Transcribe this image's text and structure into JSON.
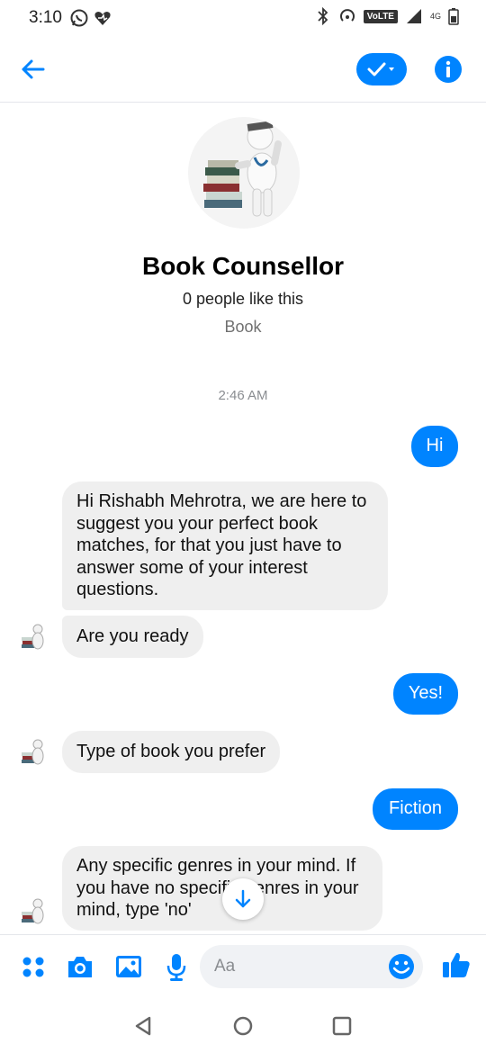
{
  "status_bar": {
    "time": "3:10",
    "volte": "VoLTE",
    "network": "4G",
    "icons": [
      "whatsapp-icon",
      "heart-icon",
      "bluetooth-icon",
      "hotspot-icon",
      "signal-icon",
      "battery-icon"
    ]
  },
  "header": {
    "icons": [
      "back-arrow-icon",
      "check-icon",
      "chevron-down-icon",
      "info-icon"
    ],
    "accent": "#0084ff"
  },
  "profile": {
    "name": "Book Counsellor",
    "likes": "0 people like this",
    "category": "Book"
  },
  "thread": {
    "timestamp": "2:46 AM",
    "messages": [
      {
        "sender": "me",
        "text": "Hi"
      },
      {
        "sender": "bot",
        "text": "Hi Rishabh Mehrotra, we are here to suggest you your perfect book matches, for that you just have to answer some of your interest questions."
      },
      {
        "sender": "bot",
        "text": "Are you ready"
      },
      {
        "sender": "me",
        "text": "Yes!"
      },
      {
        "sender": "bot",
        "text": "Type of book you prefer"
      },
      {
        "sender": "me",
        "text": "Fiction"
      },
      {
        "sender": "bot",
        "text": "Any specific genres in your mind. If you have no specific genres in your mind, type 'no'"
      }
    ]
  },
  "composer": {
    "placeholder": "Aa",
    "icons": [
      "apps-grid-icon",
      "camera-icon",
      "gallery-icon",
      "microphone-icon",
      "emoji-icon",
      "thumbs-up-icon"
    ]
  },
  "colors": {
    "outgoing_bubble": "#0084ff",
    "incoming_bubble": "#efefef"
  }
}
